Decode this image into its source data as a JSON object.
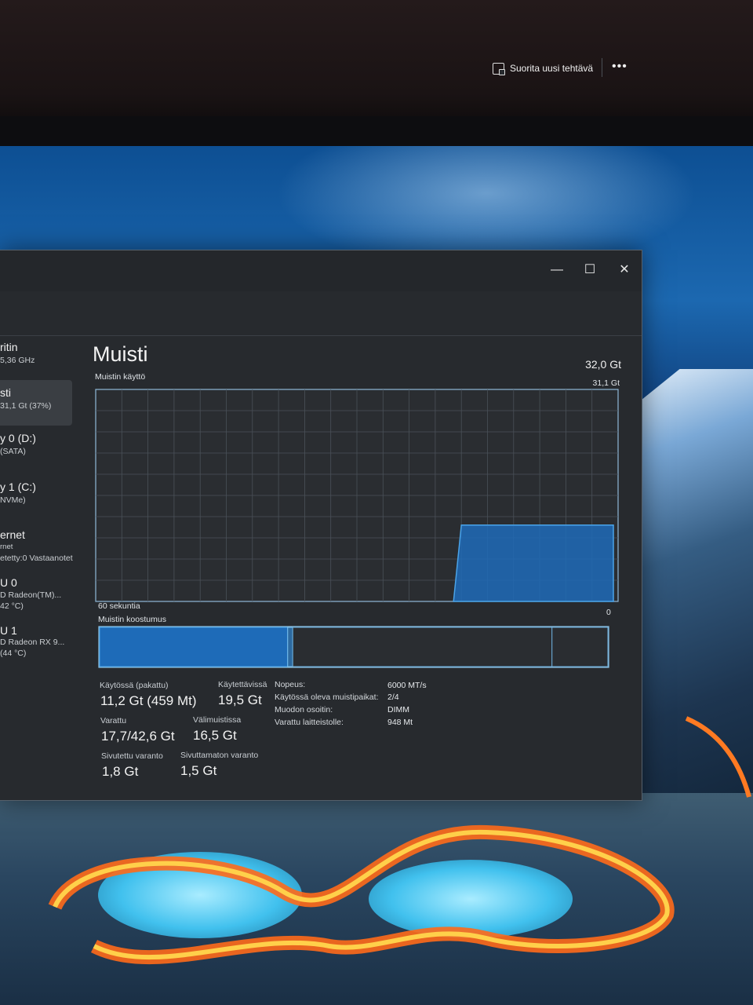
{
  "window": {
    "minimize_glyph": "—",
    "maximize_glyph": "☐",
    "close_glyph": "✕",
    "run_task_label": "Suorita uusi tehtävä",
    "run_task_icon": "run-task-icon",
    "more_glyph": "•••"
  },
  "sidebar": {
    "items": [
      {
        "title": "ritin",
        "sub": "5,36 GHz",
        "active": false
      },
      {
        "title": "sti",
        "sub": "31,1 Gt (37%)",
        "active": true
      },
      {
        "title": "y 0 (D:)",
        "sub": "(SATA)",
        "active": false
      },
      {
        "title": "y 1 (C:)",
        "sub": "NVMe)",
        "active": false
      },
      {
        "title": "ernet",
        "sub": "rnet",
        "sub2": "etetty:0 Vastaanotet",
        "active": false
      },
      {
        "title": "U 0",
        "sub": "D Radeon(TM)...",
        "sub2": "42 °C)",
        "active": false
      },
      {
        "title": "U 1",
        "sub": "D Radeon RX 9...",
        "sub2": "(44 °C)",
        "active": false
      }
    ]
  },
  "main": {
    "title": "Muisti",
    "total": "32,0 Gt",
    "usage_label": "Muistin käyttö",
    "graph_max": "31,1 Gt",
    "time_span": "60 sekuntia",
    "graph_min": "0",
    "composition_label": "Muistin koostumus",
    "usage_fraction": 0.36,
    "composition": {
      "in_use": 0.37,
      "modified": 0.01,
      "standby": 0.51,
      "free": 0.11
    }
  },
  "stats": {
    "in_use_label": "Käytössä (pakattu)",
    "in_use_value": "11,2 Gt (459 Mt)",
    "available_label": "Käytettävissä",
    "available_value": "19,5 Gt",
    "committed_label": "Varattu",
    "committed_value": "17,7/42,6 Gt",
    "cached_label": "Välimuistissa",
    "cached_value": "16,5 Gt",
    "paged_label": "Sivutettu varanto",
    "paged_value": "1,8 Gt",
    "nonpaged_label": "Sivuttamaton varanto",
    "nonpaged_value": "1,5 Gt"
  },
  "specs": [
    {
      "label": "Nopeus:",
      "value": "6000 MT/s"
    },
    {
      "label": "Käytössä oleva muistipaikat:",
      "value": "2/4"
    },
    {
      "label": "Muodon osoitin:",
      "value": "DIMM"
    },
    {
      "label": "Varattu laitteistolle:",
      "value": "948 Mt"
    }
  ],
  "colors": {
    "accent": "#1e6bb8",
    "accent_border": "#4aa3e8",
    "window_bg": "#272a2e",
    "grid": "#4a5159"
  }
}
